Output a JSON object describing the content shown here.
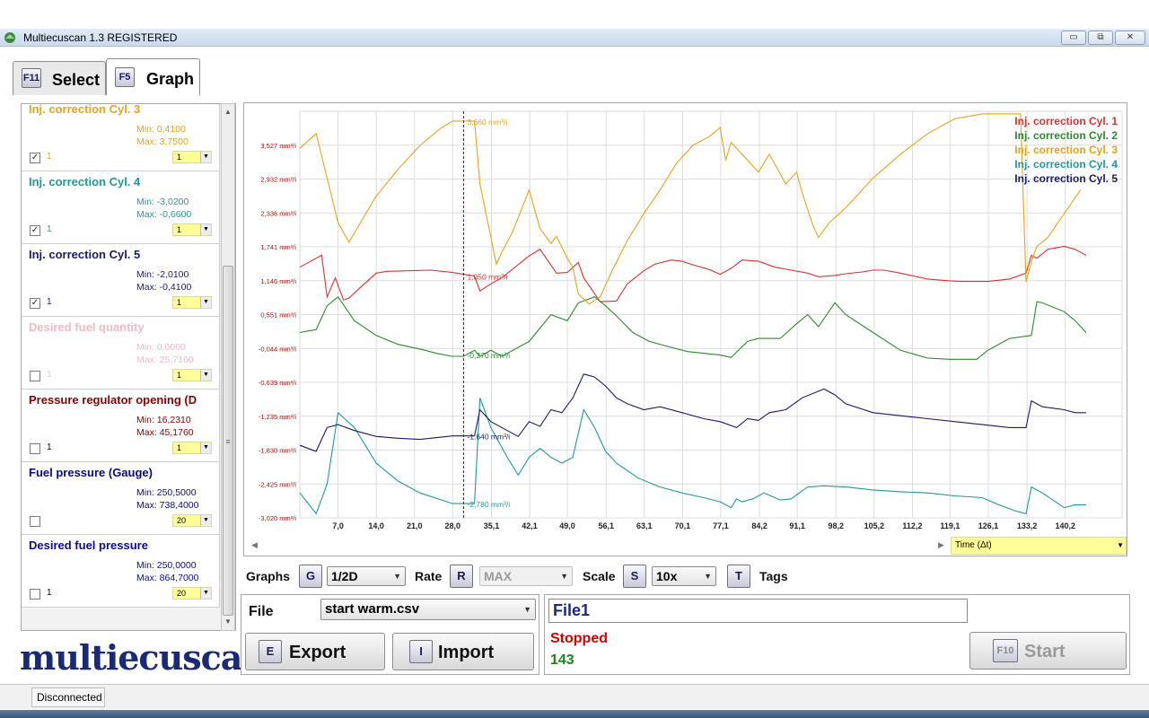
{
  "window": {
    "title": "Multiecuscan 1.3 REGISTERED",
    "min": "▭",
    "max": "⧉",
    "close": "✕"
  },
  "tabs": [
    {
      "key": "F11",
      "label": "Select"
    },
    {
      "key": "F5",
      "label": "Graph"
    }
  ],
  "params": [
    {
      "name": "Inj. correction Cyl. 3",
      "min": "Min: 0,4100",
      "max": "Max: 3,7500",
      "checked": "✓",
      "index": "1",
      "scale": "1",
      "color": "#e8a317"
    },
    {
      "name": "Inj. correction Cyl. 4",
      "min": "Min: -3,0200",
      "max": "Max: -0,6600",
      "checked": "✓",
      "index": "1",
      "scale": "1",
      "color": "#1e9a9a"
    },
    {
      "name": "Inj. correction Cyl. 5",
      "min": "Min: -2,0100",
      "max": "Max: -0,4100",
      "checked": "✓",
      "index": "1",
      "scale": "1",
      "color": "#1a1a6e"
    },
    {
      "name": "Desired fuel quantity",
      "min": "Min: 0,0000",
      "max": "Max: 25,7160",
      "checked": "",
      "index": "1",
      "scale": "1",
      "color": "#f4b8c4"
    },
    {
      "name": "Pressure regulator opening (D",
      "min": "Min: 16,2310",
      "max": "Max: 45,1760",
      "checked": "",
      "index": "1",
      "scale": "1",
      "color": "#8b0000"
    },
    {
      "name": "Fuel pressure (Gauge)",
      "min": "Min: 250,5000",
      "max": "Max: 738,4000",
      "checked": "",
      "index": "",
      "scale": "20",
      "color": "#0a0a80"
    },
    {
      "name": "Desired fuel pressure",
      "min": "Min: 250,0000",
      "max": "Max: 864,7000",
      "checked": "",
      "index": "1",
      "scale": "20",
      "color": "#0a0aa0"
    }
  ],
  "logo": "multiecuscan",
  "controls": {
    "graphs_label": "Graphs",
    "graphs_key": "G",
    "graphs_value": "1/2D",
    "rate_label": "Rate",
    "rate_key": "R",
    "rate_value": "MAX",
    "scale_label": "Scale",
    "scale_key": "S",
    "scale_value": "10x",
    "tags_key": "T",
    "tags_label": "Tags"
  },
  "file": {
    "label": "File",
    "value": "start warm.csv",
    "export_key": "E",
    "export_label": "Export",
    "import_key": "I",
    "import_label": "Import"
  },
  "status": {
    "name": "File1",
    "state": "Stopped",
    "count": "143",
    "start_key": "F10",
    "start_label": "Start",
    "state_color": "#d40000",
    "count_color": "#1a8a1a"
  },
  "time_axis": "Time (Δt)",
  "statusbar": {
    "connection": "Disconnected"
  },
  "chart_data": {
    "type": "line",
    "y_tick_labels": [
      "3,527 mm³/i",
      "2,932 mm³/i",
      "2,336 mm³/i",
      "1,741 mm³/i",
      "1,146 mm³/i",
      "0,551 mm³/i",
      "-0,044 mm³/i",
      "-0,639 mm³/i",
      "-1,235 mm³/i",
      "-1,830 mm³/i",
      "-2,425 mm³/i",
      "-3,020 mm³/i"
    ],
    "x_ticks": [
      7.0,
      14.0,
      21.0,
      28.0,
      35.1,
      42.1,
      49.0,
      56.1,
      63.1,
      70.1,
      77.1,
      84.2,
      91.1,
      98.2,
      105.2,
      112.2,
      119.1,
      126.1,
      133.2,
      140.2
    ],
    "x_tick_labels": [
      "7,0",
      "14,0",
      "21,0",
      "28,0",
      "35,1",
      "42,1",
      "49,0",
      "56,1",
      "63,1",
      "70,1",
      "77,1",
      "84,2",
      "91,1",
      "98,2",
      "105,2",
      "112,2",
      "119,1",
      "126,1",
      "133,2",
      "140,2"
    ],
    "xlim": [
      0,
      150.6
    ],
    "ylim": [
      -3.02,
      3.824
    ],
    "cursor_x": 30.0,
    "cursor_labels": [
      {
        "text": "3,660 mm³/i",
        "y": 3.66,
        "color": "#e8a317"
      },
      {
        "text": "1,050 mm³/i",
        "y": 1.05,
        "color": "#e03030"
      },
      {
        "text": "-0,270 mm³/i",
        "y": -0.27,
        "color": "#2a8a2a"
      },
      {
        "text": "-1,640 mm³/i",
        "y": -1.64,
        "color": "#1a1a6e"
      },
      {
        "text": "-2,780 mm³/i",
        "y": -2.78,
        "color": "#1e9a9a"
      }
    ],
    "grid": true,
    "legend_position": "top-right",
    "series": [
      {
        "name": "Inj. correction Cyl. 1",
        "color": "#e03030",
        "x": [
          0,
          4,
          5,
          6.5,
          8,
          9,
          11,
          14,
          16,
          20,
          24,
          28,
          30,
          32,
          33,
          35,
          37,
          42,
          44,
          47,
          49,
          51,
          52,
          55,
          58,
          60,
          63,
          65,
          68,
          70,
          72,
          75,
          77,
          79,
          81,
          84,
          87,
          90,
          93,
          95,
          98,
          100,
          103,
          105,
          107,
          110,
          112,
          115,
          119,
          121,
          126,
          130,
          133,
          134,
          135,
          137,
          140,
          142,
          144
        ],
        "y": [
          1.2,
          1.4,
          0.7,
          1.02,
          0.65,
          0.68,
          0.85,
          1.1,
          1.13,
          1.14,
          1.15,
          1.11,
          1.08,
          1.05,
          0.8,
          0.92,
          1.02,
          1.39,
          1.5,
          1.1,
          1.11,
          1.28,
          1.02,
          0.62,
          0.63,
          0.92,
          1.14,
          1.25,
          1.32,
          1.3,
          1.24,
          1.16,
          1.08,
          1.18,
          1.32,
          1.3,
          1.2,
          1.15,
          1.1,
          1.04,
          1.06,
          1.09,
          1.12,
          1.15,
          1.15,
          1.1,
          1.06,
          1.0,
          0.97,
          0.96,
          0.96,
          1.0,
          1.1,
          1.4,
          1.35,
          1.5,
          1.55,
          1.5,
          1.4
        ]
      },
      {
        "name": "Inj. correction Cyl. 2",
        "color": "#2a8a2a",
        "x": [
          0,
          3,
          5,
          7,
          10,
          14,
          18,
          23,
          25,
          28,
          30,
          32,
          33,
          35,
          37,
          42,
          46,
          49,
          51,
          54,
          56,
          58,
          61,
          64,
          68,
          71,
          77,
          79,
          82,
          84,
          88,
          91,
          93,
          95,
          98,
          100,
          105,
          110,
          115,
          119,
          124,
          126,
          130,
          134,
          135,
          136,
          140,
          142,
          144
        ],
        "y": [
          0.1,
          0.15,
          0.55,
          0.7,
          0.3,
          0.05,
          -0.1,
          -0.2,
          -0.25,
          -0.3,
          -0.3,
          -0.2,
          -0.3,
          -0.2,
          -0.3,
          -0.05,
          0.4,
          0.3,
          0.6,
          0.7,
          0.55,
          0.38,
          0.1,
          -0.05,
          -0.15,
          -0.22,
          -0.28,
          -0.32,
          -0.05,
          0.0,
          0.0,
          0.25,
          0.4,
          0.2,
          0.6,
          0.4,
          0.1,
          -0.2,
          -0.33,
          -0.35,
          -0.35,
          -0.2,
          0.0,
          0.05,
          0.62,
          0.6,
          0.45,
          0.3,
          0.1
        ]
      },
      {
        "name": "Inj. correction Cyl. 3",
        "color": "#e8a317",
        "x": [
          0,
          3,
          5,
          7,
          9,
          14,
          18,
          22,
          26,
          28,
          30,
          32,
          33,
          36,
          37,
          39,
          42,
          44,
          46,
          47,
          49,
          50,
          51,
          53,
          55,
          57,
          60,
          63,
          66,
          69,
          72,
          75,
          77,
          78,
          79,
          82,
          84,
          86,
          89,
          91,
          92,
          94,
          95,
          97,
          100,
          105,
          110,
          115,
          120,
          125,
          128,
          132,
          133,
          134,
          135,
          137,
          140,
          143
        ],
        "y": [
          3.2,
          3.45,
          2.7,
          1.95,
          1.62,
          2.4,
          2.85,
          3.25,
          3.55,
          3.66,
          3.66,
          3.66,
          2.6,
          1.25,
          1.45,
          1.8,
          2.5,
          1.85,
          1.6,
          1.72,
          1.35,
          1.2,
          0.75,
          0.58,
          0.7,
          1.1,
          1.65,
          2.1,
          2.5,
          2.95,
          3.25,
          3.4,
          3.55,
          3.0,
          3.3,
          3.0,
          2.8,
          3.1,
          2.6,
          2.8,
          2.45,
          1.9,
          1.7,
          1.95,
          2.2,
          2.7,
          3.1,
          3.45,
          3.7,
          3.78,
          3.78,
          3.78,
          0.95,
          1.3,
          1.55,
          1.7,
          2.1,
          2.5
        ]
      },
      {
        "name": "Inj. correction Cyl. 4",
        "color": "#1e9a9a",
        "x": [
          0,
          3,
          5,
          7,
          10,
          14,
          18,
          22,
          28,
          31,
          32,
          33,
          35,
          38,
          40,
          42,
          44,
          46,
          48,
          50,
          52,
          54,
          56,
          58,
          62,
          66,
          70,
          74,
          77,
          79,
          80,
          81,
          83,
          85,
          88,
          90,
          93,
          96,
          100,
          105,
          110,
          115,
          120,
          125,
          128,
          131,
          133,
          134,
          136,
          140,
          142,
          144
        ],
        "y": [
          -2.6,
          -2.95,
          -2.45,
          -1.25,
          -1.5,
          -2.1,
          -2.4,
          -2.6,
          -2.78,
          -2.78,
          -2.78,
          -1.0,
          -1.5,
          -2.0,
          -2.3,
          -2.0,
          -1.85,
          -2.0,
          -2.1,
          -2.0,
          -1.2,
          -1.5,
          -1.9,
          -2.1,
          -2.35,
          -2.5,
          -2.6,
          -2.68,
          -2.75,
          -2.85,
          -2.7,
          -2.75,
          -2.7,
          -2.6,
          -2.72,
          -2.7,
          -2.5,
          -2.48,
          -2.5,
          -2.55,
          -2.58,
          -2.6,
          -2.65,
          -2.68,
          -2.8,
          -2.9,
          -2.95,
          -2.5,
          -2.6,
          -2.85,
          -2.8,
          -2.8
        ]
      },
      {
        "name": "Inj. correction Cyl. 5",
        "color": "#1a1a6e",
        "x": [
          0,
          3,
          5,
          7,
          10,
          14,
          18,
          22,
          28,
          32,
          33,
          35,
          38,
          40,
          42,
          44,
          46,
          48,
          50,
          52,
          54,
          56,
          58,
          60,
          63,
          66,
          70,
          74,
          77,
          80,
          82,
          84,
          86,
          89,
          92,
          96,
          98,
          100,
          105,
          110,
          115,
          120,
          125,
          130,
          133,
          134,
          136,
          140,
          142,
          144
        ],
        "y": [
          -1.8,
          -1.9,
          -1.5,
          -1.45,
          -1.55,
          -1.65,
          -1.68,
          -1.7,
          -1.64,
          -1.64,
          -1.2,
          -1.4,
          -1.55,
          -1.65,
          -1.4,
          -1.48,
          -1.2,
          -1.25,
          -1.0,
          -0.6,
          -0.65,
          -0.8,
          -1.0,
          -1.1,
          -1.2,
          -1.15,
          -1.25,
          -1.35,
          -1.4,
          -1.5,
          -1.35,
          -1.38,
          -1.25,
          -1.2,
          -1.0,
          -0.85,
          -0.95,
          -1.1,
          -1.25,
          -1.3,
          -1.35,
          -1.4,
          -1.45,
          -1.5,
          -1.5,
          -1.05,
          -1.15,
          -1.2,
          -1.25,
          -1.25
        ]
      }
    ]
  }
}
